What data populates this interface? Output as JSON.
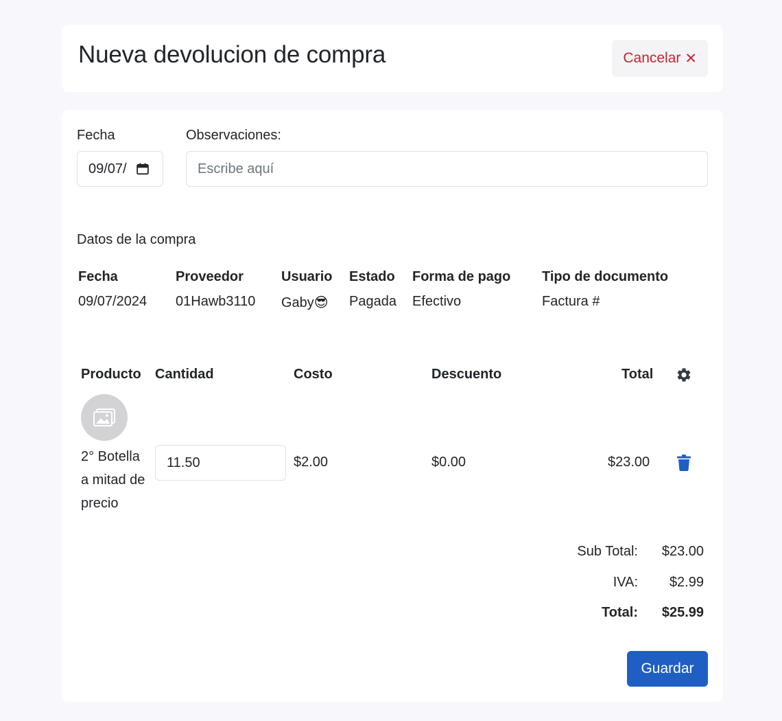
{
  "header": {
    "title": "Nueva devolucion de compra",
    "cancel_label": "Cancelar",
    "cancel_icon": "✕"
  },
  "form": {
    "date_label": "Fecha",
    "date_value": "09/07/",
    "observations_label": "Observaciones:",
    "observations_placeholder": "Escribe aquí",
    "observations_value": ""
  },
  "purchase": {
    "section_title": "Datos de la compra",
    "columns": [
      "Fecha",
      "Proveedor",
      "Usuario",
      "Estado",
      "Forma de pago",
      "Tipo de documento"
    ],
    "values": [
      "09/07/2024",
      "01Hawb3110",
      "Gaby😎",
      "Pagada",
      "Efectivo",
      "Factura #"
    ]
  },
  "products": {
    "columns": [
      "Producto",
      "Cantidad",
      "Costo",
      "Descuento",
      "Total"
    ],
    "rows": [
      {
        "name": "2° Botella a mitad de precio",
        "quantity": "11.50",
        "cost": "$2.00",
        "discount": "$0.00",
        "total": "$23.00"
      }
    ]
  },
  "summary": {
    "subtotal_label": "Sub Total:",
    "subtotal_value": "$23.00",
    "iva_label": "IVA:",
    "iva_value": "$2.99",
    "total_label": "Total:",
    "total_value": "$25.99"
  },
  "actions": {
    "save_label": "Guardar"
  },
  "colors": {
    "primary": "#1f5fc4",
    "danger": "#c82333",
    "background": "#f8f7fc"
  }
}
